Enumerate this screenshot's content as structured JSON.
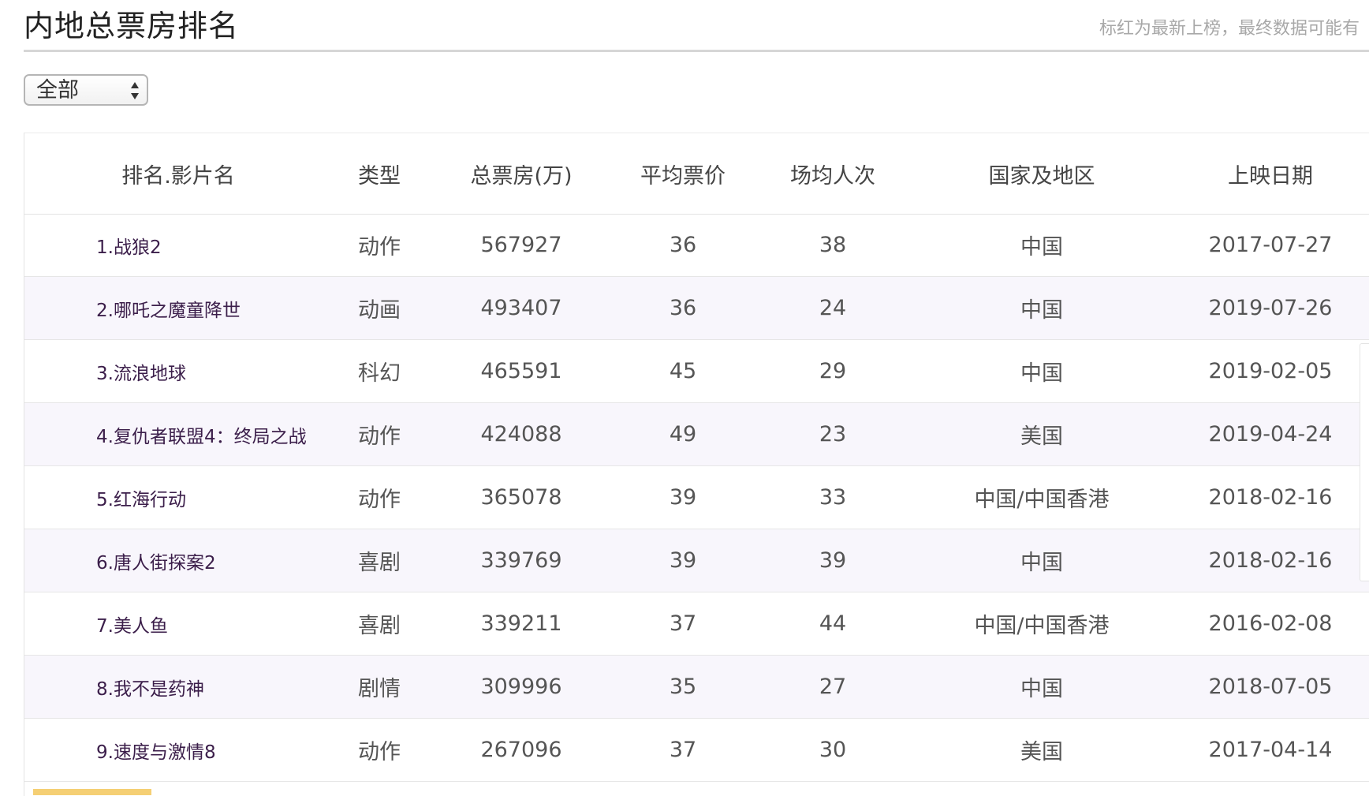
{
  "header": {
    "title": "内地总票房排名",
    "notice": "标红为最新上榜，最终数据可能有"
  },
  "filter": {
    "selected": "全部"
  },
  "table": {
    "columns": [
      "排名.影片名",
      "类型",
      "总票房(万)",
      "平均票价",
      "场均人次",
      "国家及地区",
      "上映日期"
    ],
    "rows": [
      {
        "name": "1.战狼2",
        "type": "动作",
        "box_office": "567927",
        "avg_price": "36",
        "avg_audience": "38",
        "country": "中国",
        "date": "2017-07-27"
      },
      {
        "name": "2.哪吒之魔童降世",
        "type": "动画",
        "box_office": "493407",
        "avg_price": "36",
        "avg_audience": "24",
        "country": "中国",
        "date": "2019-07-26"
      },
      {
        "name": "3.流浪地球",
        "type": "科幻",
        "box_office": "465591",
        "avg_price": "45",
        "avg_audience": "29",
        "country": "中国",
        "date": "2019-02-05"
      },
      {
        "name": "4.复仇者联盟4：终局之战",
        "type": "动作",
        "box_office": "424088",
        "avg_price": "49",
        "avg_audience": "23",
        "country": "美国",
        "date": "2019-04-24"
      },
      {
        "name": "5.红海行动",
        "type": "动作",
        "box_office": "365078",
        "avg_price": "39",
        "avg_audience": "33",
        "country": "中国/中国香港",
        "date": "2018-02-16"
      },
      {
        "name": "6.唐人街探案2",
        "type": "喜剧",
        "box_office": "339769",
        "avg_price": "39",
        "avg_audience": "39",
        "country": "中国",
        "date": "2018-02-16"
      },
      {
        "name": "7.美人鱼",
        "type": "喜剧",
        "box_office": "339211",
        "avg_price": "37",
        "avg_audience": "44",
        "country": "中国/中国香港",
        "date": "2016-02-08"
      },
      {
        "name": "8.我不是药神",
        "type": "剧情",
        "box_office": "309996",
        "avg_price": "35",
        "avg_audience": "27",
        "country": "中国",
        "date": "2018-07-05"
      },
      {
        "name": "9.速度与激情8",
        "type": "动作",
        "box_office": "267096",
        "avg_price": "37",
        "avg_audience": "30",
        "country": "美国",
        "date": "2017-04-14"
      }
    ]
  },
  "colors": {
    "title_rule": "#d6d6d6",
    "row_alt_bg": "#f8f6fc",
    "film_name": "#3b1e4a",
    "notice_text": "#a8a8a8",
    "bottom_accent": "#f5cf74"
  }
}
